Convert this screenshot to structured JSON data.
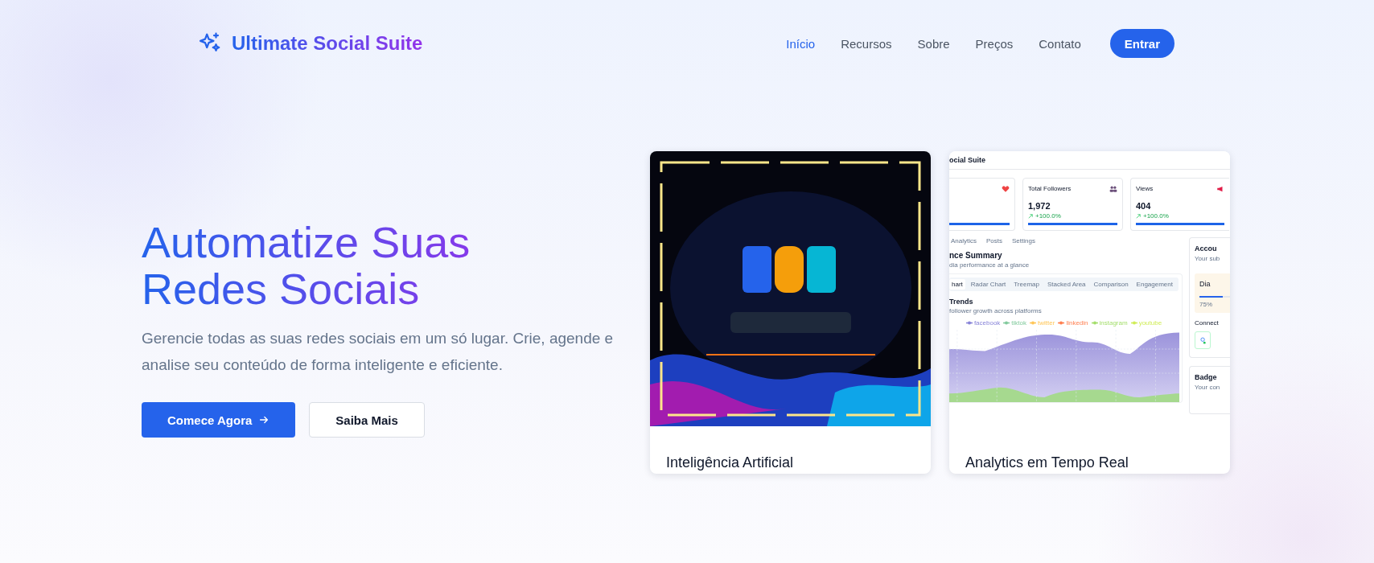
{
  "brand": {
    "name": "Ultimate Social Suite"
  },
  "nav": [
    {
      "label": "Início",
      "selected": true
    },
    {
      "label": "Recursos",
      "selected": false
    },
    {
      "label": "Sobre",
      "selected": false
    },
    {
      "label": "Preços",
      "selected": false
    },
    {
      "label": "Contato",
      "selected": false
    }
  ],
  "login_button": "Entrar",
  "hero": {
    "title": "Automatize Suas Redes Sociais",
    "subtitle": "Gerencie todas as suas redes sociais em um só lugar. Crie, agende e analise seu conteúdo de forma inteligente e eficiente.",
    "primary_button": "Comece Agora",
    "secondary_button": "Saiba Mais"
  },
  "cards": [
    {
      "title": "Inteligência Artificial",
      "kind": "picture"
    },
    {
      "title": "Analytics em Tempo Real",
      "kind": "dashboard"
    }
  ],
  "dashboard": {
    "header": "ocial Suite",
    "stats": [
      {
        "level": 1
      },
      {
        "label": "Total Followers",
        "value": "1,972",
        "change": "+100.0%",
        "level": 1
      },
      {
        "label": "Views",
        "value": "404",
        "change": "+100.0%",
        "level": 1
      }
    ],
    "tabs": [
      "Analytics",
      "Posts",
      "Settings"
    ],
    "section_title": "nce Summary",
    "section_subtitle": "dia performance at a glance",
    "chart_tabs": [
      {
        "label": "hart",
        "selected": true
      },
      {
        "label": "Radar Chart",
        "selected": false
      },
      {
        "label": "Treemap",
        "selected": false
      },
      {
        "label": "Stacked Area",
        "selected": false
      },
      {
        "label": "Comparison",
        "selected": false
      },
      {
        "label": "Engagement",
        "selected": false
      }
    ],
    "chart_title": "Trends",
    "chart_subtitle": "follower growth across platforms",
    "legend": [
      {
        "label": "facebook",
        "color": "#8884d8"
      },
      {
        "label": "tiktok",
        "color": "#82ca9d"
      },
      {
        "label": "twitter",
        "color": "#ffc658"
      },
      {
        "label": "linkedin",
        "color": "#ff7f50"
      },
      {
        "label": "instagram",
        "color": "#a4de6c"
      },
      {
        "label": "youtube",
        "color": "#d0ed57"
      }
    ],
    "side": {
      "title": "Accou",
      "subtitle": "Your sub",
      "plan": {
        "title": "Dia",
        "level": 0.75,
        "percent": "75%"
      },
      "connect_label": "Connect",
      "badges_title": "Badge",
      "badges_subtitle": "Your con"
    }
  }
}
